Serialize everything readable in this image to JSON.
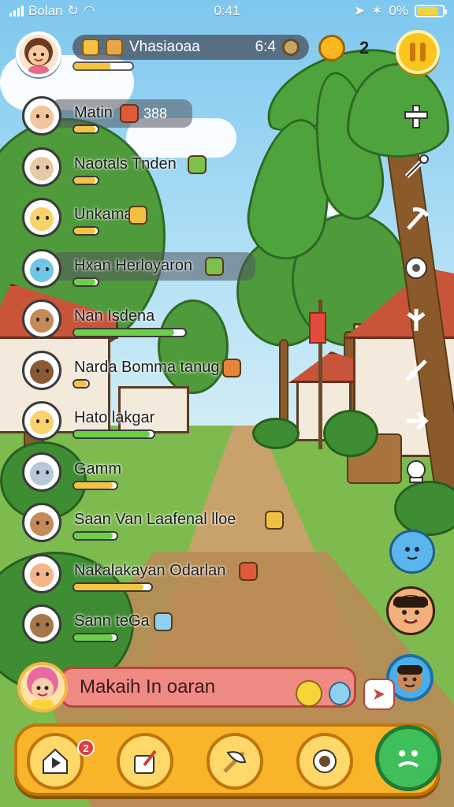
{
  "status_bar": {
    "carrier": "Bolan",
    "time": "0:41",
    "battery": "0%",
    "battery_level": 0.85
  },
  "hud": {
    "player_name": "Vhasiaoaa",
    "timer": "6:4",
    "xp_level": 0.62,
    "sun_count": "2",
    "icons": {
      "avatar": "player-avatar",
      "pause": "pause-icon",
      "sun": "sun-icon"
    }
  },
  "players": [
    {
      "name": "Matin",
      "extra": "388",
      "progress": 0.0,
      "bar_color": "#f5c242",
      "skin": "#f3c59a"
    },
    {
      "name": "Naotals Tnden",
      "progress": 0.2,
      "bar_color": "#f5c242",
      "skin": "#e9c9a3"
    },
    {
      "name": "Unkama",
      "progress": 0.2,
      "bar_color": "#f5c242",
      "skin": "#f7d36a"
    },
    {
      "name": "Hxan Herloyaron",
      "progress": 0.15,
      "bar_color": "#6ccf4a",
      "skin": "#6fc6e8"
    },
    {
      "name": "Nan Isdena",
      "progress": 0.65,
      "bar_color": "#6ccf4a",
      "skin": "#c58a5a"
    },
    {
      "name": "Narda Bomma tanug",
      "progress": 0.15,
      "bar_color": "#f5c242",
      "skin": "#8a5a35"
    },
    {
      "name": "Hato lakgar",
      "progress": 0.95,
      "bar_color": "#6ccf4a",
      "skin": "#f7d36a"
    },
    {
      "name": "Gamm",
      "progress": 0.35,
      "bar_color": "#f5c242",
      "skin": "#b7c8d8"
    },
    {
      "name": "Saan Van Laafenal lloe",
      "progress": 0.3,
      "bar_color": "#6ccf4a",
      "skin": "#c58a5a"
    },
    {
      "name": "Nakalakayan Odarlan",
      "progress": 0.9,
      "bar_color": "#f5c242",
      "skin": "#f3b58a"
    },
    {
      "name": "Sann teGa",
      "progress": 0.1,
      "bar_color": "#6ccf4a",
      "skin": "#a8764a"
    }
  ],
  "chat": {
    "value": "Makaih In oaran"
  },
  "toolbar": {
    "notification_count": "2",
    "buttons": [
      "home-play",
      "edit-shop",
      "crafting",
      "camera",
      "emote"
    ]
  },
  "colors": {
    "toolbar": "#f8b52a",
    "accent_green": "#3fbf5a",
    "chat_field": "#f08a84"
  }
}
